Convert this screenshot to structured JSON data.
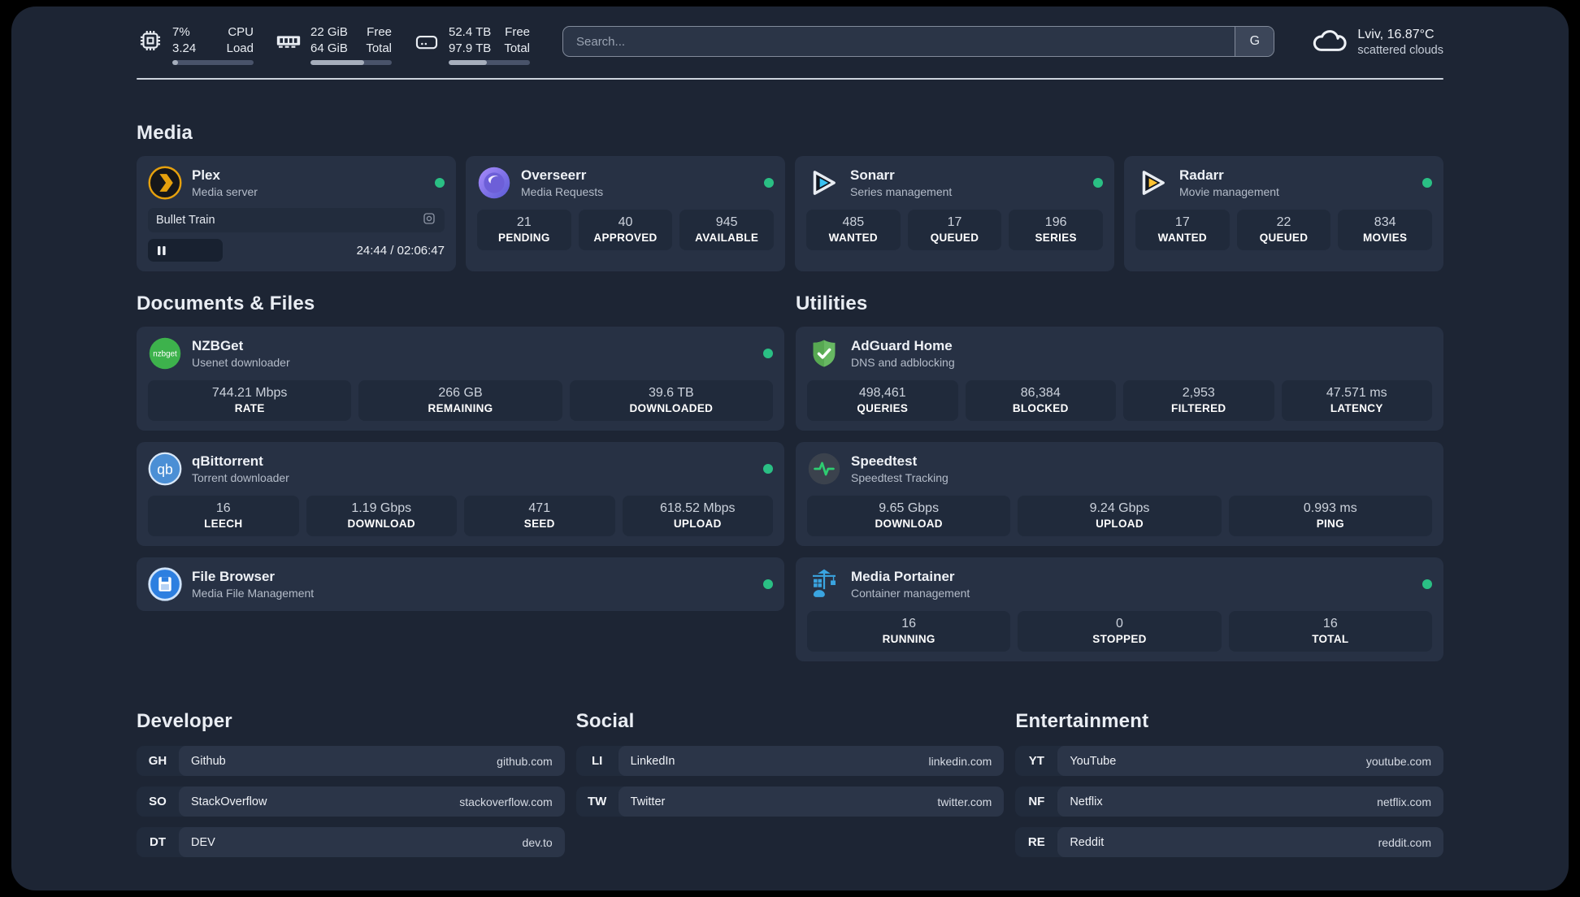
{
  "topbar": {
    "stats": [
      {
        "icon": "cpu-icon",
        "value_top": "7%",
        "value_bottom": "3.24",
        "label_top": "CPU",
        "label_bottom": "Load",
        "progress_percent": 7
      },
      {
        "icon": "ram-icon",
        "value_top": "22 GiB",
        "value_bottom": "64 GiB",
        "label_top": "Free",
        "label_bottom": "Total",
        "progress_percent": 66
      },
      {
        "icon": "disk-icon",
        "value_top": "52.4 TB",
        "value_bottom": "97.9 TB",
        "label_top": "Free",
        "label_bottom": "Total",
        "progress_percent": 47
      }
    ],
    "search": {
      "placeholder": "Search...",
      "button_label": "G"
    },
    "weather": {
      "icon": "cloud-icon",
      "location_temp": "Lviv, 16.87°C",
      "condition": "scattered clouds"
    }
  },
  "sections": {
    "media": {
      "title": "Media",
      "plex": {
        "icon": "plex-icon",
        "name": "Plex",
        "description": "Media server",
        "status": "online",
        "now_playing": {
          "title": "Bullet Train",
          "time": "24:44 / 02:06:47"
        }
      },
      "overseerr": {
        "icon": "overseerr-icon",
        "name": "Overseerr",
        "description": "Media Requests",
        "status": "online",
        "stats": [
          {
            "value": "21",
            "label": "PENDING"
          },
          {
            "value": "40",
            "label": "APPROVED"
          },
          {
            "value": "945",
            "label": "AVAILABLE"
          }
        ]
      },
      "sonarr": {
        "icon": "sonarr-icon",
        "name": "Sonarr",
        "description": "Series management",
        "status": "online",
        "stats": [
          {
            "value": "485",
            "label": "WANTED"
          },
          {
            "value": "17",
            "label": "QUEUED"
          },
          {
            "value": "196",
            "label": "SERIES"
          }
        ]
      },
      "radarr": {
        "icon": "radarr-icon",
        "name": "Radarr",
        "description": "Movie management",
        "status": "online",
        "stats": [
          {
            "value": "17",
            "label": "WANTED"
          },
          {
            "value": "22",
            "label": "QUEUED"
          },
          {
            "value": "834",
            "label": "MOVIES"
          }
        ]
      }
    },
    "documents": {
      "title": "Documents & Files",
      "nzbget": {
        "icon": "nzbget-icon",
        "name": "NZBGet",
        "description": "Usenet downloader",
        "status": "online",
        "stats": [
          {
            "value": "744.21 Mbps",
            "label": "RATE"
          },
          {
            "value": "266 GB",
            "label": "REMAINING"
          },
          {
            "value": "39.6 TB",
            "label": "DOWNLOADED"
          }
        ]
      },
      "qbittorrent": {
        "icon": "qbittorrent-icon",
        "name": "qBittorrent",
        "description": "Torrent downloader",
        "status": "online",
        "stats": [
          {
            "value": "16",
            "label": "LEECH"
          },
          {
            "value": "1.19 Gbps",
            "label": "DOWNLOAD"
          },
          {
            "value": "471",
            "label": "SEED"
          },
          {
            "value": "618.52 Mbps",
            "label": "UPLOAD"
          }
        ]
      },
      "filebrowser": {
        "icon": "filebrowser-icon",
        "name": "File Browser",
        "description": "Media File Management",
        "status": "online"
      }
    },
    "utilities": {
      "title": "Utilities",
      "adguard": {
        "icon": "adguard-icon",
        "name": "AdGuard Home",
        "description": "DNS and adblocking",
        "stats": [
          {
            "value": "498,461",
            "label": "QUERIES"
          },
          {
            "value": "86,384",
            "label": "BLOCKED"
          },
          {
            "value": "2,953",
            "label": "FILTERED"
          },
          {
            "value": "47.571 ms",
            "label": "LATENCY"
          }
        ]
      },
      "speedtest": {
        "icon": "speedtest-icon",
        "name": "Speedtest",
        "description": "Speedtest Tracking",
        "stats": [
          {
            "value": "9.65 Gbps",
            "label": "DOWNLOAD"
          },
          {
            "value": "9.24 Gbps",
            "label": "UPLOAD"
          },
          {
            "value": "0.993 ms",
            "label": "PING"
          }
        ]
      },
      "portainer": {
        "icon": "portainer-icon",
        "name": "Media Portainer",
        "description": "Container management",
        "status": "online",
        "stats": [
          {
            "value": "16",
            "label": "RUNNING"
          },
          {
            "value": "0",
            "label": "STOPPED"
          },
          {
            "value": "16",
            "label": "TOTAL"
          }
        ]
      }
    },
    "developer": {
      "title": "Developer",
      "links": [
        {
          "abbr": "GH",
          "name": "Github",
          "url": "github.com"
        },
        {
          "abbr": "SO",
          "name": "StackOverflow",
          "url": "stackoverflow.com"
        },
        {
          "abbr": "DT",
          "name": "DEV",
          "url": "dev.to"
        }
      ]
    },
    "social": {
      "title": "Social",
      "links": [
        {
          "abbr": "LI",
          "name": "LinkedIn",
          "url": "linkedin.com"
        },
        {
          "abbr": "TW",
          "name": "Twitter",
          "url": "twitter.com"
        }
      ]
    },
    "entertainment": {
      "title": "Entertainment",
      "links": [
        {
          "abbr": "YT",
          "name": "YouTube",
          "url": "youtube.com"
        },
        {
          "abbr": "NF",
          "name": "Netflix",
          "url": "netflix.com"
        },
        {
          "abbr": "RE",
          "name": "Reddit",
          "url": "reddit.com"
        }
      ]
    }
  },
  "colors": {
    "status_online": "#2abf84",
    "panel_bg": "#1d2534",
    "card_bg": "#273144",
    "plex_accent": "#e5a00d"
  }
}
